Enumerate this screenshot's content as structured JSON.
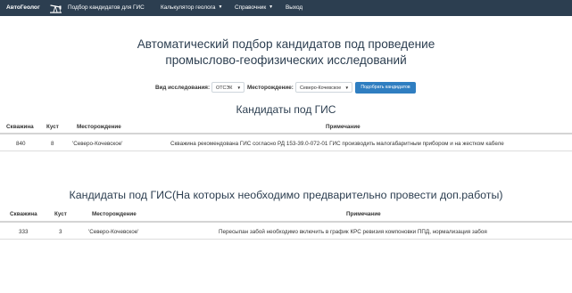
{
  "navbar": {
    "brand": "АвтоГеолог",
    "items": [
      {
        "label": "Подбор кандидатов для ГИС"
      },
      {
        "label": "Калькулятор геолога"
      },
      {
        "label": "Справочник"
      },
      {
        "label": "Выход"
      }
    ]
  },
  "page": {
    "title_line1": "Автоматический подбор кандидатов под проведение",
    "title_line2": "промыслово-геофизических исследований"
  },
  "form": {
    "research_label": "Вид исследования:",
    "research_value": "ОТСЭК",
    "field_label": "Месторождение:",
    "field_value": "Северо-Кочевское",
    "submit_label": "Подобрать кандидатов"
  },
  "section1": {
    "title": "Кандидаты под ГИС",
    "headers": [
      "Скважина",
      "Куст",
      "Месторождение",
      "Примечание"
    ],
    "rows": [
      {
        "well": "840",
        "pad": "8",
        "field": "'Северо-Кочевское'",
        "note": "Скважина рекомендована ГИС согласно РД 153-39.0-072-01 ГИС производить малогабаритным прибором и на жестком кабеле"
      }
    ]
  },
  "section2": {
    "title": "Кандидаты под ГИС(На которых необходимо предварительно провести доп.работы)",
    "headers": [
      "Скважина",
      "Куст",
      "Месторождение",
      "Примечание"
    ],
    "rows": [
      {
        "well": "333",
        "pad": "3",
        "field": "'Северо-Кочевское'",
        "note": "Пересыпан забой необходимо включить в график КРС ревизия компоновки ППД, нормализация забоя"
      }
    ]
  },
  "colors": {
    "navbar": "#2c3e50",
    "primary_button": "#2f7ec1",
    "heading": "#2c3e50"
  },
  "icons": {
    "brand_logo": "oil-pump-icon",
    "dropdown": "caret-down-icon"
  }
}
